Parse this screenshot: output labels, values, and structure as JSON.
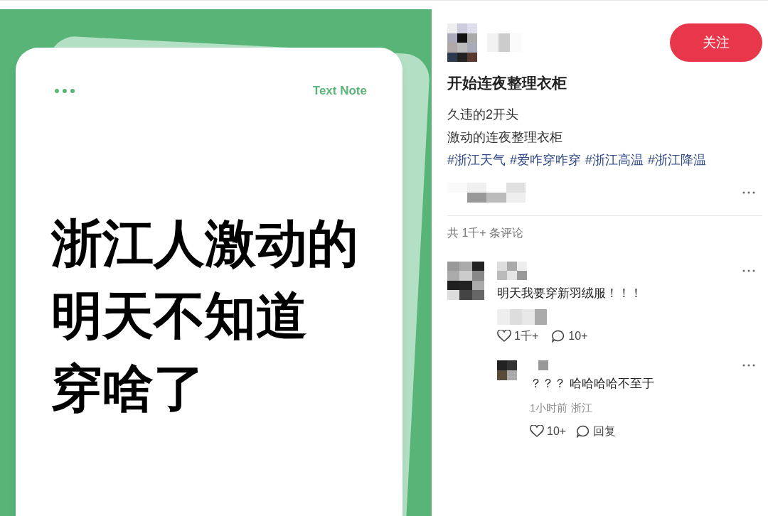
{
  "note_card": {
    "badge": "Text Note",
    "lines": [
      "浙江人激动的",
      "明天不知道",
      "穿啥了"
    ]
  },
  "post": {
    "follow_button": "关注",
    "title": "开始连夜整理衣柜",
    "body": [
      "久违的2开头",
      "激动的连夜整理衣柜"
    ],
    "tags": [
      "#浙江天气",
      "#爱咋穿咋穿",
      "#浙江高温",
      "#浙江降温"
    ]
  },
  "comments_count": "共 1千+ 条评论",
  "comments": [
    {
      "text": "明天我要穿新羽绒服！！！",
      "likes": "1千+",
      "replies": "10+",
      "children": [
        {
          "text": "？？？ 哈哈哈哈不至于",
          "meta": "1小时前 浙江",
          "likes": "10+",
          "reply": "回复"
        }
      ]
    }
  ]
}
